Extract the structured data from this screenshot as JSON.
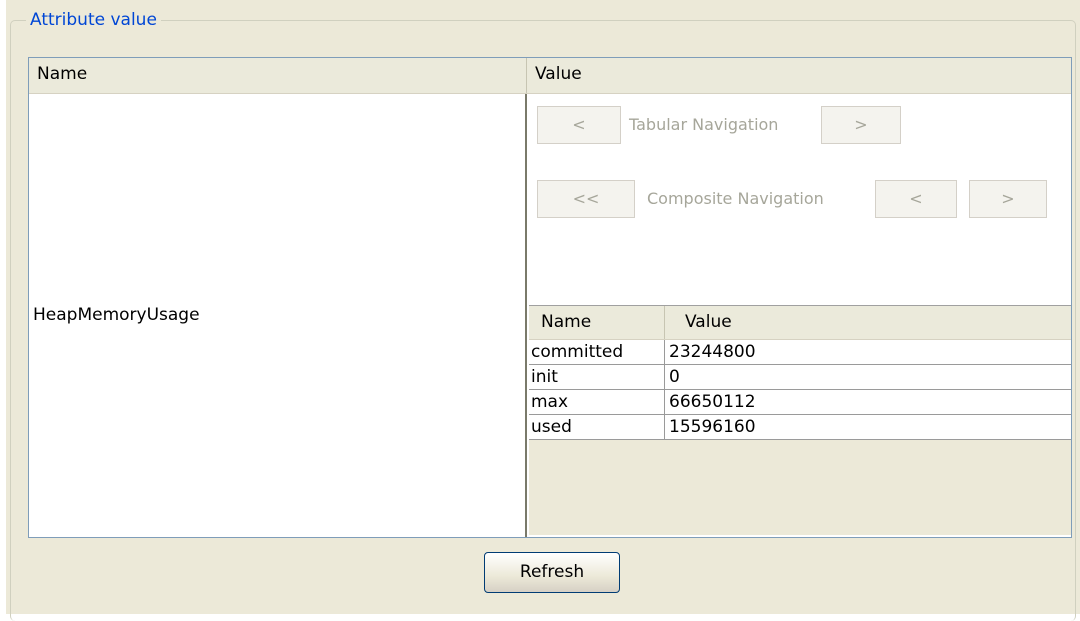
{
  "group": {
    "title": "Attribute value"
  },
  "outer_table": {
    "columns": [
      "Name",
      "Value"
    ],
    "attribute_name": "HeapMemoryUsage"
  },
  "navigation": {
    "tabular_prev": "<",
    "tabular_label": "Tabular Navigation",
    "tabular_next": ">",
    "composite_first": "<<",
    "composite_label": "Composite Navigation",
    "composite_prev": "<",
    "composite_next": ">"
  },
  "inner_table": {
    "columns": [
      "Name",
      "Value"
    ],
    "rows": [
      {
        "name": "committed",
        "value": "23244800"
      },
      {
        "name": "init",
        "value": "0"
      },
      {
        "name": "max",
        "value": "66650112"
      },
      {
        "name": "used",
        "value": "15596160"
      }
    ]
  },
  "actions": {
    "refresh_label": "Refresh"
  }
}
